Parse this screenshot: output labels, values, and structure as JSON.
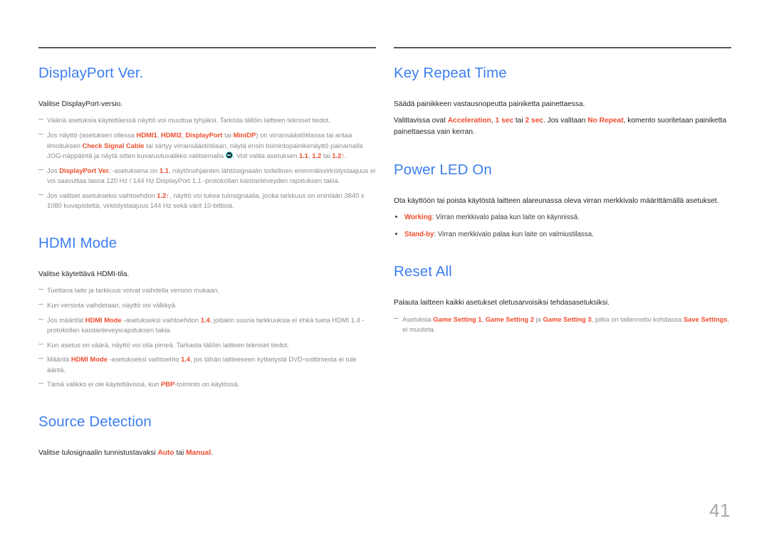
{
  "page": {
    "number": "41"
  },
  "columns": {
    "left": [
      {
        "id": "displayport-ver",
        "title": "DisplayPort Ver.",
        "lead": "Valitse DisplayPort-versio.",
        "notes": [
          {
            "parts": [
              {
                "t": "Vääriä asetuksia käytettäessä näyttö voi muuttua tyhjäksi. Tarkista tällöin laitteen tekniset tiedot."
              }
            ]
          },
          {
            "parts": [
              {
                "t": "Jos näyttö (asetuksen ollessa "
              },
              {
                "t": "HDMI1",
                "hl": true
              },
              {
                "t": ", "
              },
              {
                "t": "HDMI2",
                "hl": true
              },
              {
                "t": ", "
              },
              {
                "t": "DisplayPort",
                "hl": true
              },
              {
                "t": " tai "
              },
              {
                "t": "MiniDP",
                "hl": true
              },
              {
                "t": ") on virransäästötilassa tai antaa ilmoituksen "
              },
              {
                "t": "Check Signal Cable",
                "hl": true
              },
              {
                "t": " tai siirtyy virransäästötilaan, näytä ensin toimintopainikenäyttö painamalla JOG-näppäintä ja näytä sitten kuvaruutuvalikko valitsemalla "
              },
              {
                "icon": "jog-button-icon"
              },
              {
                "t": ". Voit valita asetuksen "
              },
              {
                "t": "1.1",
                "hl": true
              },
              {
                "t": ", "
              },
              {
                "t": "1.2",
                "hl": true
              },
              {
                "t": " tai "
              },
              {
                "t": "1.2↑",
                "hl": true
              },
              {
                "t": "."
              }
            ]
          },
          {
            "parts": [
              {
                "t": "Jos "
              },
              {
                "t": "DisplayPort Ver.",
                "hl": true
              },
              {
                "t": " -asetuksena on "
              },
              {
                "t": "1.1",
                "hl": true
              },
              {
                "t": ", näytönohjainten lähtösignaalin todellinen enimmäisvirkistystaajuus ei voi saavuttaa tasoa 120 Hz / 144 Hz DisplayPort 1.1 -protokollan kaistanleveyden rajoituksen takia."
              }
            ]
          },
          {
            "parts": [
              {
                "t": "Jos valitset asetukseksi vaihtoehdon "
              },
              {
                "t": "1.2↑",
                "hl": true
              },
              {
                "t": ", näyttö voi tukea tulosignaalia, jonka tarkkuus on enintään 3840 x 1080 kuvapistettä, virkistystaajuus 144 Hz sekä värit 10-bittisiä."
              }
            ]
          }
        ]
      },
      {
        "id": "hdmi-mode",
        "title": "HDMI Mode",
        "lead": "Valitse käytettävä HDMI-tila.",
        "notes": [
          {
            "parts": [
              {
                "t": "Tuettava laite ja tarkkuus voivat vaihdella version mukaan."
              }
            ]
          },
          {
            "parts": [
              {
                "t": "Kun versiota vaihdetaan, näyttö voi välkkyä."
              }
            ]
          },
          {
            "parts": [
              {
                "t": "Jos määrität "
              },
              {
                "t": "HDMI Mode",
                "hl": true
              },
              {
                "t": " -asetukseksi vaihtoehdon "
              },
              {
                "t": "1.4",
                "hl": true
              },
              {
                "t": ", joitakin suuria tarkkuuksia ei ehkä tueta HDMI 1.4 -protokollan kaistanleveysrajoituksen takia."
              }
            ]
          },
          {
            "parts": [
              {
                "t": "Kun asetus on väärä, näyttö voi olla pimeä. Tarkasta tällöin laitteen tekniset tiedot."
              }
            ]
          },
          {
            "parts": [
              {
                "t": "Määritä "
              },
              {
                "t": "HDMI Mode",
                "hl": true
              },
              {
                "t": " -asetukseksi vaihtoehto "
              },
              {
                "t": "1.4",
                "hl": true
              },
              {
                "t": ", jos tähän laitteeseen kytketystä DVD-soittimesta ei tule ääntä."
              }
            ]
          },
          {
            "parts": [
              {
                "t": "Tämä valikko ei ole käytettävissä, kun "
              },
              {
                "t": "PBP",
                "hl": true
              },
              {
                "t": "-toiminto on käytössä."
              }
            ]
          }
        ]
      },
      {
        "id": "source-detection",
        "title": "Source Detection",
        "lead_parts": [
          {
            "t": "Valitse tulosignaalin tunnistustavaksi "
          },
          {
            "t": "Auto",
            "hl": true
          },
          {
            "t": " tai "
          },
          {
            "t": "Manual",
            "hl": true
          },
          {
            "t": "."
          }
        ],
        "notes": []
      }
    ],
    "right": [
      {
        "id": "key-repeat-time",
        "title": "Key Repeat Time",
        "lead": "Säädä painikkeen vastausnopeutta painiketta painettaessa.",
        "paragraphs": [
          {
            "parts": [
              {
                "t": "Valittavissa ovat "
              },
              {
                "t": "Acceleration",
                "hl": true
              },
              {
                "t": ", "
              },
              {
                "t": "1 sec",
                "hl": true
              },
              {
                "t": " tai "
              },
              {
                "t": "2 sec",
                "hl": true
              },
              {
                "t": ". Jos valitaan "
              },
              {
                "t": "No Repeat",
                "hl": true
              },
              {
                "t": ", komento suoritetaan painiketta painettaessa vain kerran."
              }
            ]
          }
        ],
        "notes": []
      },
      {
        "id": "power-led-on",
        "title": "Power LED On",
        "lead": "Ota käyttöön tai poista käytöstä laitteen alareunassa oleva virran merkkivalo määrittämällä asetukset.",
        "bullets": [
          {
            "parts": [
              {
                "t": "Working",
                "hl": true
              },
              {
                "t": ": Virran merkkivalo palaa kun laite on käynnissä."
              }
            ]
          },
          {
            "parts": [
              {
                "t": "Stand-by",
                "hl": true
              },
              {
                "t": ": Virran merkkivalo palaa kun laite on valmiustilassa."
              }
            ]
          }
        ],
        "notes": []
      },
      {
        "id": "reset-all",
        "title": "Reset All",
        "lead": "Palauta laitteen kaikki asetukset oletusarvoisiksi tehdasasetuksiksi.",
        "notes": [
          {
            "parts": [
              {
                "t": "Asetuksia "
              },
              {
                "t": "Game Setting 1",
                "hl": true
              },
              {
                "t": ", "
              },
              {
                "t": "Game Setting 2",
                "hl": true
              },
              {
                "t": " ja "
              },
              {
                "t": "Game Setting 3",
                "hl": true
              },
              {
                "t": ", jotka on tallennettu kohdassa "
              },
              {
                "t": "Save Settings",
                "hl": true
              },
              {
                "t": ", ei muuteta."
              }
            ]
          }
        ]
      }
    ]
  },
  "colors": {
    "heading": "#3d7ef0",
    "highlight": "#ee4d2d",
    "note_text": "#8c8c8c",
    "body_text": "#231f20",
    "rule": "#58585a",
    "page_number": "#a9a9a9"
  }
}
